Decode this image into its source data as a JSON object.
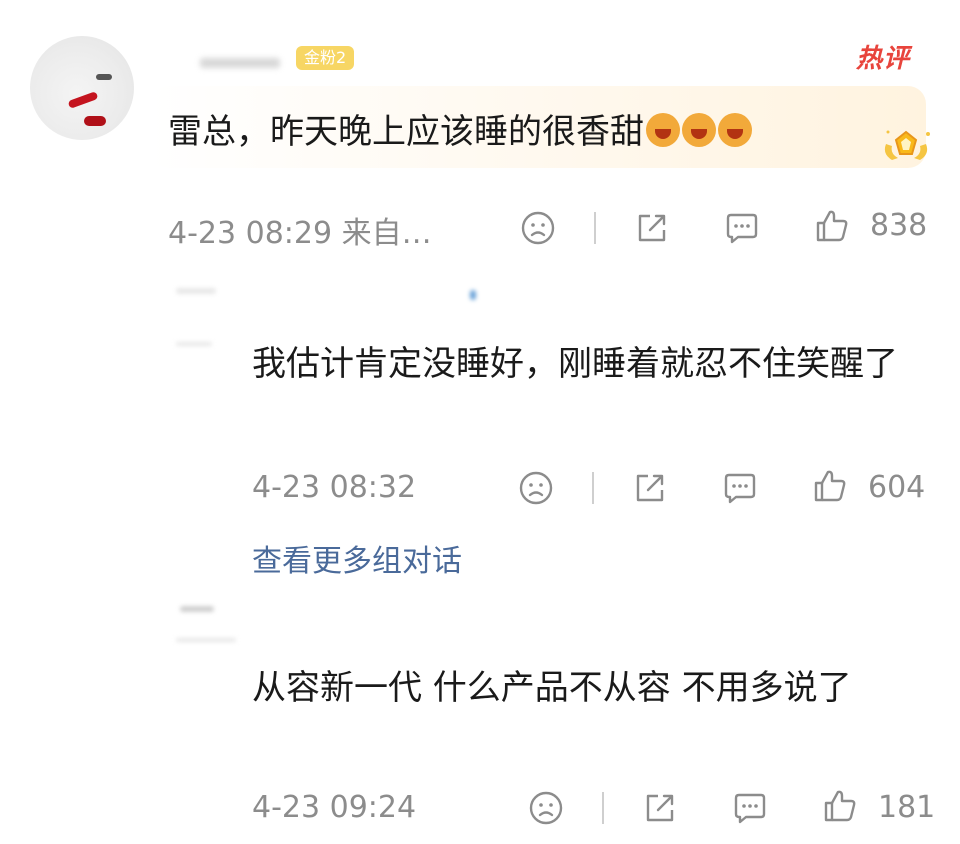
{
  "comment": {
    "fan_badge": "金粉2",
    "hot_label": "热评",
    "text": "雷总，昨天晚上应该睡的很香甜",
    "meta": "4-23 08:29  来自…",
    "likes": "838"
  },
  "replies": [
    {
      "text": "我估计肯定没睡好，刚睡着就忍不住笑醒了",
      "time": "4-23 08:32",
      "likes": "604"
    },
    {
      "text": "从容新一代 什么产品不从容 不用多说了",
      "time": "4-23 09:24",
      "likes": "181"
    }
  ],
  "more_conversations": "查看更多组对话",
  "colors": {
    "accent": "#e8443c",
    "link": "#4a6a9a",
    "meta": "#8c8c8c"
  }
}
